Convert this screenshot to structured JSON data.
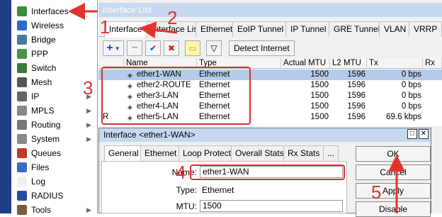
{
  "sidebar": {
    "items": [
      {
        "label": "Interfaces",
        "icon": "interfaces-icon",
        "color": "#3a8f3a",
        "chevron": false
      },
      {
        "label": "Wireless",
        "icon": "wireless-icon",
        "color": "#2e6bc6",
        "chevron": false
      },
      {
        "label": "Bridge",
        "icon": "bridge-icon",
        "color": "#4a7a9a",
        "chevron": false
      },
      {
        "label": "PPP",
        "icon": "ppp-icon",
        "color": "#4a8f4a",
        "chevron": false
      },
      {
        "label": "Switch",
        "icon": "switch-icon",
        "color": "#3a7a3a",
        "chevron": false
      },
      {
        "label": "Mesh",
        "icon": "mesh-icon",
        "color": "#555555",
        "chevron": false
      },
      {
        "label": "IP",
        "icon": "ip-icon",
        "color": "#666666",
        "chevron": true
      },
      {
        "label": "MPLS",
        "icon": "mpls-icon",
        "color": "#888888",
        "chevron": true
      },
      {
        "label": "Routing",
        "icon": "routing-icon",
        "color": "#777777",
        "chevron": true
      },
      {
        "label": "System",
        "icon": "system-icon",
        "color": "#888888",
        "chevron": true
      },
      {
        "label": "Queues",
        "icon": "queues-icon",
        "color": "#c0392b",
        "chevron": false
      },
      {
        "label": "Files",
        "icon": "files-icon",
        "color": "#3a6ac6",
        "chevron": false
      },
      {
        "label": "Log",
        "icon": "log-icon",
        "color": "#f0f0f0",
        "chevron": false
      },
      {
        "label": "RADIUS",
        "icon": "radius-icon",
        "color": "#2a4aa0",
        "chevron": false
      },
      {
        "label": "Tools",
        "icon": "tools-icon",
        "color": "#7a5a3a",
        "chevron": true
      }
    ]
  },
  "window": {
    "title": "Interface List"
  },
  "tabs": [
    {
      "label": "Interface",
      "active": true
    },
    {
      "label": "Interface List",
      "active": false
    },
    {
      "label": "Ethernet",
      "active": false
    },
    {
      "label": "EoIP Tunnel",
      "active": false
    },
    {
      "label": "IP Tunnel",
      "active": false
    },
    {
      "label": "GRE Tunnel",
      "active": false
    },
    {
      "label": "VLAN",
      "active": false
    },
    {
      "label": "VRRP",
      "active": false
    }
  ],
  "toolbar": {
    "add": "+",
    "remove": "−",
    "enable": "✔",
    "disable": "✖",
    "comment": "▭",
    "filter": "▽",
    "detect_label": "Detect Internet"
  },
  "table": {
    "columns": [
      "",
      "Name",
      "Type",
      "Actual MTU",
      "L2 MTU",
      "Tx",
      "Rx"
    ],
    "rows": [
      {
        "flag": "",
        "name": "ether1-WAN",
        "type": "Ethernet",
        "mtu": "1500",
        "l2mtu": "1596",
        "tx": "0 bps",
        "selected": true
      },
      {
        "flag": "",
        "name": "ether2-ROUTE",
        "type": "Ethernet",
        "mtu": "1500",
        "l2mtu": "1596",
        "tx": "0 bps",
        "selected": false
      },
      {
        "flag": "",
        "name": "ether3-LAN",
        "type": "Ethernet",
        "mtu": "1500",
        "l2mtu": "1596",
        "tx": "0 bps",
        "selected": false
      },
      {
        "flag": "",
        "name": "ether4-LAN",
        "type": "Ethernet",
        "mtu": "1500",
        "l2mtu": "1596",
        "tx": "0 bps",
        "selected": false
      },
      {
        "flag": "R",
        "name": "ether5-LAN",
        "type": "Ethernet",
        "mtu": "1500",
        "l2mtu": "1596",
        "tx": "69.6 kbps",
        "selected": false
      }
    ]
  },
  "dialog": {
    "title": "Interface <ether1-WAN>",
    "tabs": [
      "General",
      "Ethernet",
      "Loop Protect",
      "Overall Stats",
      "Rx Stats",
      "..."
    ],
    "fields": {
      "name_label": "Name:",
      "name_value": "ether1-WAN",
      "type_label": "Type:",
      "type_value": "Ethernet",
      "mtu_label": "MTU:",
      "mtu_value": "1500"
    },
    "buttons": {
      "ok": "OK",
      "cancel": "Cancel",
      "apply": "Apply",
      "disable": "Disable"
    }
  },
  "annotations": {
    "n1": "1",
    "n2": "2",
    "n3": "3",
    "n4": "4",
    "n5": "5"
  },
  "colors": {
    "annotation": "#e2342d",
    "selection": "#b5cbea",
    "sidebar_strip": "#1d3f87"
  }
}
